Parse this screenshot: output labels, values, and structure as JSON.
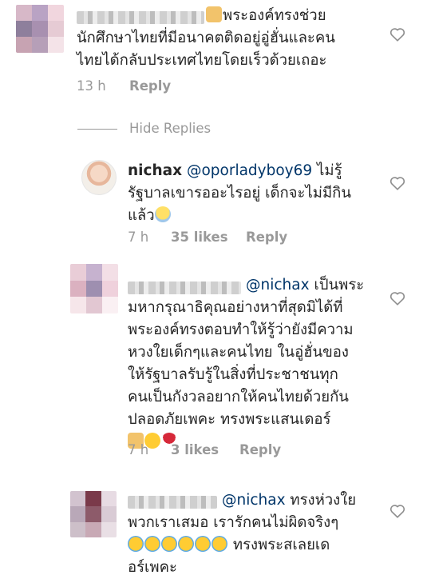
{
  "comments": [
    {
      "username": "",
      "text_line1": "พระองค์ทรงช่วย",
      "text_line2": "นักศึกษาไทยที่มีอนาคตติดอยู่อู่ฮั่นและคน",
      "text_line3": "ไทยได้กลับประเทศไทยโดยเร็วด้วยเถอะ",
      "time": "13 h",
      "likes": "",
      "reply": "Reply"
    },
    {
      "username": "nichax",
      "mention": "@oporladyboy69",
      "text_line1": " ไม่รู้",
      "text_line2": "รัฐบาลเขารออะไรอยู่ เด็กจะไม่มีกิน",
      "text_line3": "แล้ว",
      "time": "7 h",
      "likes": "35 likes",
      "reply": "Reply"
    },
    {
      "username": "",
      "mention": "@nichax",
      "text_line1": " เป็นพระ",
      "text_line2": "มหากรุณาธิคุณอย่างหาที่สุดมิได้ที่",
      "text_line3": "พระองค์ทรงตอบทำให้รู้ว่ายังมีความ",
      "text_line4": "หวงใยเด็กๆและคนไทย ในอู่ฮั่นของ",
      "text_line5": "ให้รัฐบาลรับรู้ในสิ่งที่ประชาชนทุก",
      "text_line6": "คนเป็นกังวลอยากให้คนไทยด้วยกัน",
      "text_line7": "ปลอดภัยเพคะ ทรงพระแสนเดอร์",
      "time": "7 h",
      "likes": "3 likes",
      "reply": "Reply"
    },
    {
      "username": "",
      "mention": "@nichax",
      "text_line1": " ทรงห่วงใย",
      "text_line2": "พวกเราเสมอ เรารักคนไม่ผิดจริงๆ",
      "text_line3": " ทรงพระสเลยเด",
      "text_line4": "อร์เพคะ"
    }
  ],
  "hide_replies": "Hide Replies",
  "icons": {
    "heart": "heart-outline-icon",
    "pray": "folded-hands-emoji",
    "scream": "face-screaming-emoji",
    "heart_eyes": "heart-eyes-emoji",
    "rose": "rose-emoji",
    "sob": "crying-face-emoji"
  },
  "colors": {
    "text": "#262626",
    "meta": "#999999",
    "mention": "#003569"
  }
}
